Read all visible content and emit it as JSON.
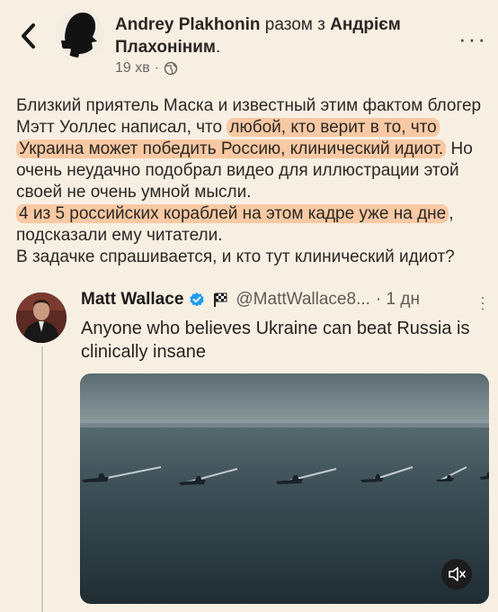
{
  "header": {
    "author_name": "Andrey Plakhonin",
    "with_text": " разом з ",
    "co_author": "Андрієм Плахоніним",
    "co_author_suffix": ".",
    "time": "19 хв",
    "dot": "·",
    "back_icon": "chevron-left-icon",
    "more_icon": "more-horizontal-icon",
    "more_label": "···"
  },
  "post": {
    "segments": [
      "Близкий приятель Маска и известный этим фактом блогер Мэтт Уоллес написал, что ",
      "любой, кто верит в то, что Украина может победить Россию, клинический идиот.",
      " Но очень неудачно подобрал видео для иллюстрации этой своей не очень умной мысли.",
      "4 из 5 российских кораблей на этом кадре уже на дне",
      ", подсказали ему читатели.",
      "В задачке спрашивается, и кто тут клинический идиот?"
    ],
    "highlight_color": "#f8c9a4"
  },
  "quote": {
    "name": "Matt Wallace",
    "handle": "@MattWallace8...",
    "time": "· 1 дн",
    "more": "⋮",
    "text": "Anyone who believes Ukraine can beat Russia is clinically insane",
    "verified_color": "#1d9bf0"
  }
}
